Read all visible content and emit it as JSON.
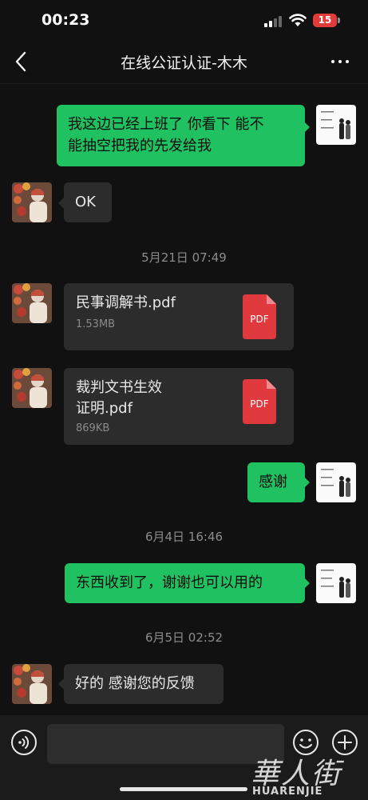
{
  "status_bar": {
    "time": "00:23",
    "battery": "15"
  },
  "header": {
    "title": "在线公证认证-木木"
  },
  "messages": {
    "m1": {
      "text_line1": "我这边已经上班了 你看下 能不",
      "text_line2": "能抽空把我的先发给我"
    },
    "m2": {
      "text": "OK"
    },
    "ts1": "5月21日 07:49",
    "file1": {
      "name": "民事调解书.pdf",
      "size": "1.53MB",
      "icon_label": "PDF"
    },
    "file2": {
      "name_line1": "裁判文书生效",
      "name_line2": "证明.pdf",
      "size": "869KB",
      "icon_label": "PDF"
    },
    "m3": {
      "text": "感谢"
    },
    "ts2": "6月4日 16:46",
    "m4": {
      "text": "东西收到了，谢谢也可以用的"
    },
    "ts3": "6月5日 02:52",
    "m5": {
      "text": "好的 感谢您的反馈"
    }
  },
  "watermark": {
    "cn": "華人街",
    "en": "HUARENJIE"
  },
  "colors": {
    "accent": "#20c160",
    "pdf": "#e0393e",
    "bg": "#111111"
  },
  "icons": [
    "back-icon",
    "more-icon",
    "voice-icon",
    "emoji-icon",
    "plus-icon",
    "pdf-icon"
  ]
}
